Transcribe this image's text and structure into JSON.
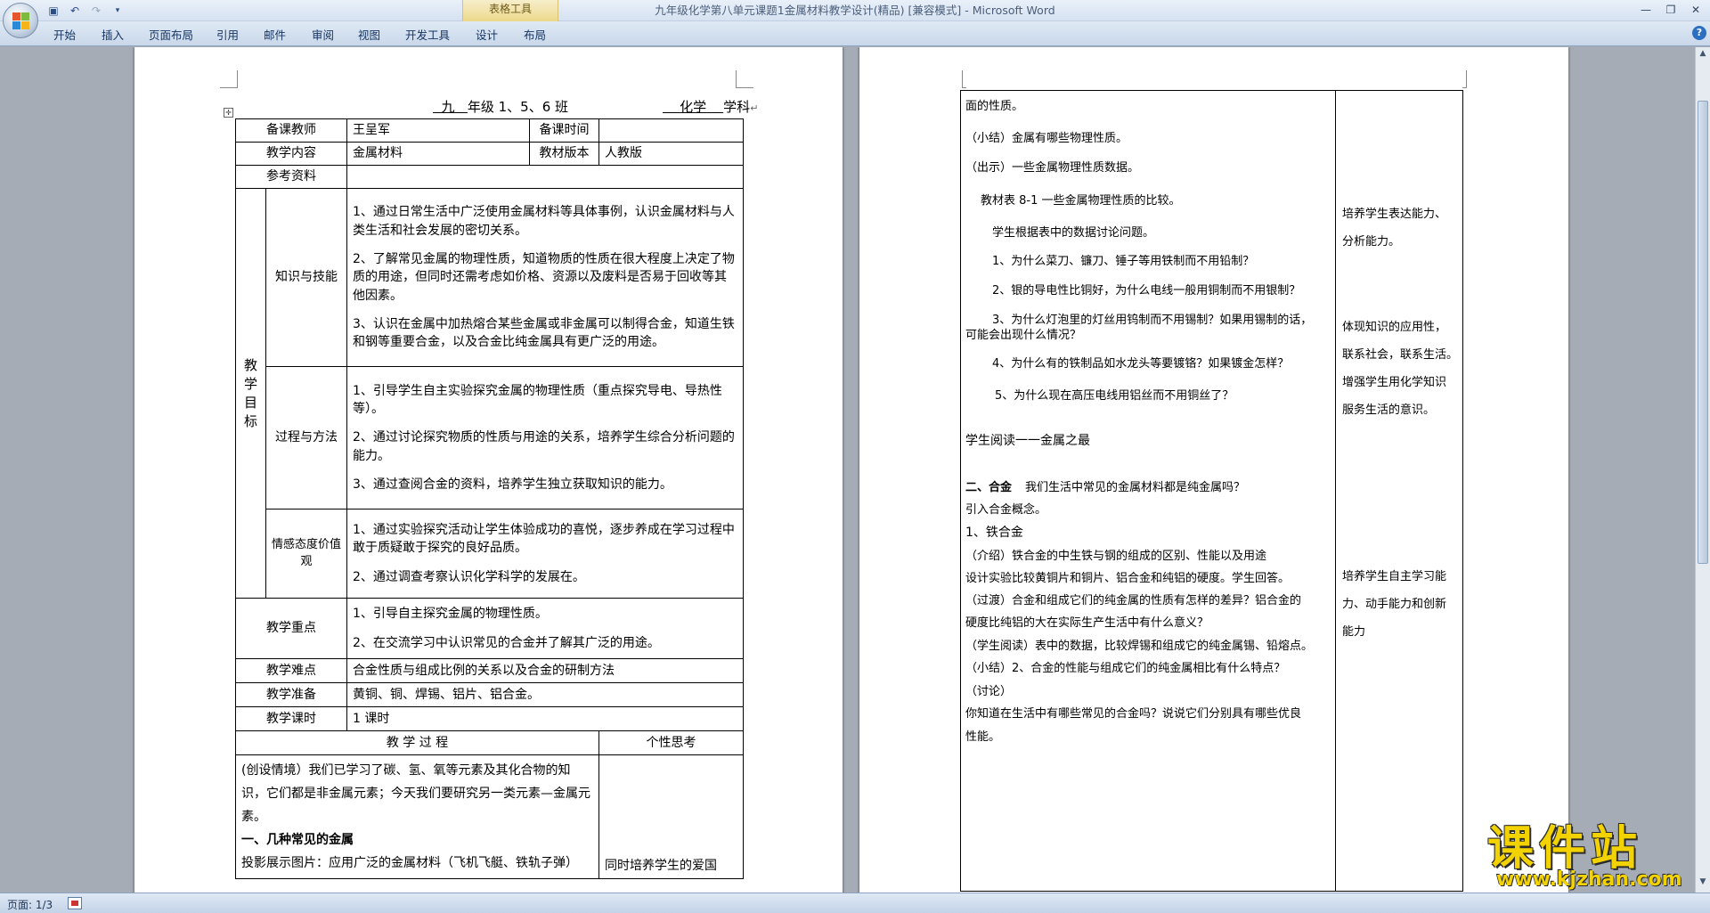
{
  "window": {
    "title": "九年级化学第八单元课题1金属材料教学设计(精品) [兼容模式] - Microsoft Word",
    "contextual_group": "表格工具"
  },
  "ribbon": {
    "tabs": [
      "开始",
      "插入",
      "页面布局",
      "引用",
      "邮件",
      "审阅",
      "视图",
      "开发工具",
      "设计",
      "布局"
    ]
  },
  "status": {
    "page": "页面: 1/3"
  },
  "page1": {
    "header": {
      "grade": "九",
      "grade_suffix": "年级 1、5、6 班",
      "subject": "化学",
      "subject_suffix": "学科"
    },
    "rows": {
      "teacher_label": "备课教师",
      "teacher": "王呈军",
      "time_label": "备课时间",
      "content_label": "教学内容",
      "content": "金属材料",
      "edition_label": "教材版本",
      "edition": "人教版",
      "ref_label": "参考资料",
      "goal_label": "教学目标",
      "k_label": "知识与技能",
      "k1": "1、通过日常生活中广泛使用金属材料等具体事例，认识金属材料与人类生活和社会发展的密切关系。",
      "k2": "2、了解常见金属的物理性质，知道物质的性质在很大程度上决定了物质的用途，但同时还需考虑如价格、资源以及废料是否易于回收等其他因素。",
      "k3": "3、认识在金属中加热熔合某些金属或非金属可以制得合金，知道生铁和钢等重要合金，以及合金比纯金属具有更广泛的用途。",
      "m_label": "过程与方法",
      "m1": "1、引导学生自主实验探究金属的物理性质（重点探究导电、导热性等）。",
      "m2": "2、通过讨论探究物质的性质与用途的关系，培养学生综合分析问题的能力。",
      "m3": "3、通过查阅合金的资料，培养学生独立获取知识的能力。",
      "e_label": "情感态度价值观",
      "e1": "1、通过实验探究活动让学生体验成功的喜悦，逐步养成在学习过程中敢于质疑敢于探究的良好品质。",
      "e2": "2、通过调查考察认识化学科学的发展在。",
      "key_label": "教学重点",
      "key1": "1、引导自主探究金属的物理性质。",
      "key2": "2、在交流学习中认识常见的合金并了解其广泛的用途。",
      "diff_label": "教学难点",
      "diff": "合金性质与组成比例的关系以及合金的研制方法",
      "prep_label": "教学准备",
      "prep": "黄铜、铜、焊锡、铝片、铝合金。",
      "hours_label": "教学课时",
      "hours": "1 课时",
      "process_label": "教 学 过 程",
      "reflect_label": "个性思考",
      "p1": "(创设情境）我们已学习了碳、氢、氧等元素及其化合物的知识，它们都是非金属元素；今天我们要研究另一类元素—金属元素。",
      "p2": "一、几种常见的金属",
      "p3": "投影展示图片：应用广泛的金属材料（飞机飞艇、铁轨子弹）",
      "r3": "同时培养学生的爱国"
    }
  },
  "page2": {
    "lines": [
      "面的性质。",
      "（小结）金属有哪些物理性质。",
      "（出示）一些金属物理性质数据。",
      "教材表 8-1 一些金属物理性质的比较。",
      "学生根据表中的数据讨论问题。",
      "1、为什么菜刀、镰刀、锤子等用铁制而不用铅制？",
      "2、银的导电性比铜好，为什么电线一般用铜制而不用银制？",
      "3、为什么灯泡里的灯丝用钨制而不用锡制？如果用锡制的话，",
      "可能会出现什么情况？",
      "4、为什么有的铁制品如水龙头等要镀铬？如果镀金怎样？",
      "5、为什么现在高压电线用铝丝而不用铜丝了？",
      "学生阅读一一金属之最",
      "二、合金",
      "我们生活中常见的金属材料都是纯金属吗？",
      "引入合金概念。",
      "1、铁合金",
      "（介绍）铁合金的中生铁与钢的组成的区别、性能以及用途",
      "设计实验比较黄铜片和铜片、铝合金和纯铝的硬度。学生回答。",
      "（过渡）合金和组成它们的纯金属的性质有怎样的差异？铝合金的",
      "硬度比纯铝的大在实际生产生活中有什么意义？",
      "（学生阅读）表中的数据，比较焊锡和组成它的纯金属锡、铅熔点。",
      "（小结）2、合金的性能与组成它们的纯金属相比有什么特点？",
      "（讨论）",
      "你知道在生活中有哪些常见的合金吗？说说它们分别具有哪些优良",
      "性能。"
    ],
    "notes": {
      "n1a": "培养学生表达能力、",
      "n1b": "分析能力。",
      "n2a": "体现知识的应用性，",
      "n2b": "联系社会，联系生活。",
      "n2c": "增强学生用化学知识",
      "n2d": "服务生活的意识。",
      "n3a": "培养学生自主学习能",
      "n3b": "力、动手能力和创新",
      "n3c": "能力"
    }
  },
  "watermark": {
    "main": "课件站",
    "url": "www.kjzhan.com"
  }
}
